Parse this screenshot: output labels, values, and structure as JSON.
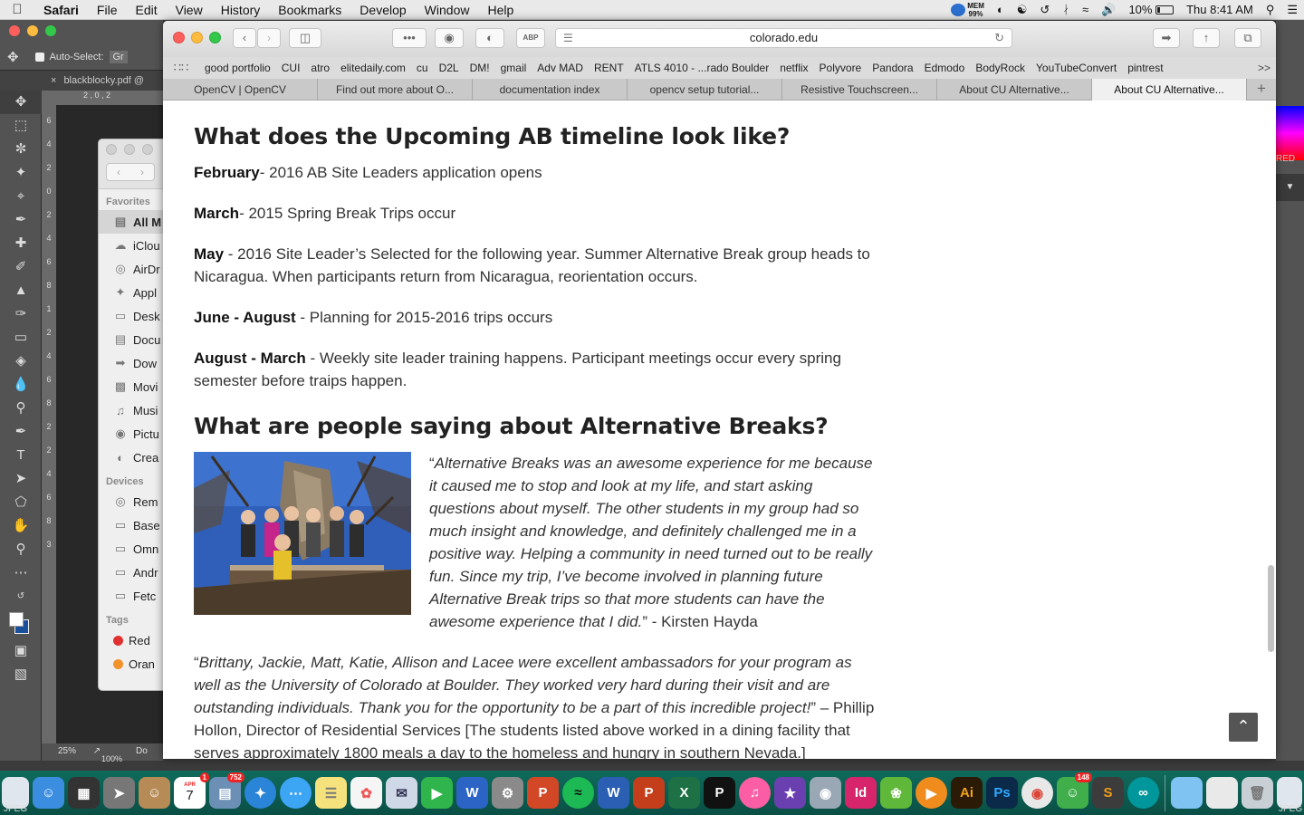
{
  "menubar": {
    "app": "Safari",
    "items": [
      "File",
      "Edit",
      "View",
      "History",
      "Bookmarks",
      "Develop",
      "Window",
      "Help"
    ],
    "mem_label": "MEM",
    "mem_value": "99%",
    "battery": "10%",
    "clock": "Thu 8:41 AM"
  },
  "photoshop": {
    "auto_select_label": "Auto-Select:",
    "auto_select_value": "Gr",
    "doc_tab": "blackblocky.pdf @",
    "zoom": "25%",
    "zoom2": "100%",
    "doc_label": "Do",
    "right_label": "RED",
    "ruler_marks": [
      "6",
      "4",
      "2",
      "0",
      "2",
      "4",
      "6",
      "8",
      "1",
      "2",
      "4",
      "6",
      "8",
      "2",
      "2",
      "4",
      "6",
      "8",
      "3"
    ],
    "hruler_marks": "2 , 0 , 2"
  },
  "finder": {
    "favorites_label": "Favorites",
    "favorites": [
      "All M",
      "iClou",
      "AirDr",
      "Appl",
      "Desk",
      "Docu",
      "Dow",
      "Movi",
      "Musi",
      "Pictu",
      "Crea"
    ],
    "devices_label": "Devices",
    "devices": [
      "Rem",
      "Base",
      "Omn",
      "Andr",
      "Fetc"
    ],
    "tags_label": "Tags",
    "tags": [
      {
        "name": "Red",
        "color": "#e0302f"
      },
      {
        "name": "Oran",
        "color": "#f2922a"
      }
    ]
  },
  "safari": {
    "url": "colorado.edu",
    "bookmarks": [
      "good portfolio",
      "CUI",
      "atro",
      "elitedaily.com",
      "cu",
      "D2L",
      "DM!",
      "gmail",
      "Adv MAD",
      "RENT",
      "ATLS 4010 - ...rado Boulder",
      "netflix",
      "Polyvore",
      "Pandora",
      "Edmodo",
      "BodyRock",
      "YouTubeConvert",
      "pintrest"
    ],
    "bookmarks_more": ">>",
    "tabs": [
      "OpenCV | OpenCV",
      "Find out more about O...",
      "documentation index",
      "opencv setup tutorial...",
      "Resistive Touchscreen...",
      "About CU Alternative...",
      "About CU Alternative..."
    ],
    "active_tab_index": 6
  },
  "page": {
    "heading1": "What does the Upcoming AB timeline look like?",
    "timeline": [
      {
        "term": "February",
        "text": "- 2016 AB Site Leaders application opens"
      },
      {
        "term": "March",
        "text": "- 2015 Spring Break Trips occur"
      },
      {
        "term": "May",
        "text": " - 2016 Site Leader’s Selected for the following year. Summer Alternative Break group heads to Nicaragua. When participants return from Nicaragua, reorientation occurs."
      },
      {
        "term": "June - August",
        "text": " - Planning for 2015-2016 trips occurs"
      },
      {
        "term": "August - March",
        "text": " - Weekly site leader training happens. Participant meetings occur every spring semester before traips happen."
      }
    ],
    "heading2": "What are people saying about Alternative Breaks?",
    "quote1_open": "“",
    "quote1_text": "Alternative Breaks was an awesome experience for me because it caused me to stop and look at my life, and start asking questions about myself.  The other students in my group had so much insight and knowledge, and definitely challenged me in a positive way.  Helping a community in need turned out to be really fun. Since my trip, I’ve become involved in planning future Alternative Break trips so that more students can have the awesome experience that I did.",
    "quote1_attr": "”  - Kirsten Hayda",
    "quote2_open": "“",
    "quote2_text": "Brittany, Jackie, Matt, Katie, Allison and Lacee were excellent ambassadors for your program as well as the University of Colorado at Boulder. They worked very hard during their visit and are outstanding individuals. Thank you for the opportunity to be a part of this incredible project!",
    "quote2_attr": "” – Phillip Hollon, Director of Residential Services [The students listed above worked in a dining facility that serves approximately 1800 meals a day to the homeless and hungry in southern Nevada.]"
  },
  "dock": {
    "calendar_month": "APR",
    "calendar_day": "7",
    "calendar_badge": "1",
    "preview_badge": "752",
    "cartoon_badge": "148",
    "jpeg_label": "JPEG",
    "apps": [
      {
        "name": "finder-icon",
        "color": "#3b8de0"
      },
      {
        "name": "dashboard-icon",
        "color": "#333"
      },
      {
        "name": "launchpad-icon",
        "color": "#777"
      },
      {
        "name": "contacts-icon",
        "color": "#b68b55"
      },
      {
        "name": "calendar-icon",
        "color": "#fff"
      },
      {
        "name": "preview-icon",
        "color": "#6c8fb6"
      },
      {
        "name": "safari-icon",
        "color": "#2a84d8"
      },
      {
        "name": "messages-icon",
        "color": "#3ca5f4"
      },
      {
        "name": "notes-icon",
        "color": "#f6e27c"
      },
      {
        "name": "photos-icon",
        "color": "#f5f5f5"
      },
      {
        "name": "mail-icon",
        "color": "#cfd8e6"
      },
      {
        "name": "facetime-icon",
        "color": "#2fb54c"
      },
      {
        "name": "word-icon",
        "color": "#2b64c4"
      },
      {
        "name": "system-prefs-icon",
        "color": "#8a8a8a"
      },
      {
        "name": "powerpoint-icon",
        "color": "#d24726"
      },
      {
        "name": "spotify-icon",
        "color": "#1db954"
      },
      {
        "name": "word2-icon",
        "color": "#2b5fb3"
      },
      {
        "name": "powerpoint2-icon",
        "color": "#c43e1c"
      },
      {
        "name": "excel-icon",
        "color": "#1e7145"
      },
      {
        "name": "pandora-icon",
        "color": "#111"
      },
      {
        "name": "itunes-icon",
        "color": "#fb5ea4"
      },
      {
        "name": "imovie-icon",
        "color": "#6a3fb0"
      },
      {
        "name": "image-capture-icon",
        "color": "#9aa7b4"
      },
      {
        "name": "indesign-icon",
        "color": "#d6256b"
      },
      {
        "name": "leaf-icon",
        "color": "#5fb83a"
      },
      {
        "name": "vlc-icon",
        "color": "#f08c1e"
      },
      {
        "name": "illustrator-icon",
        "color": "#2b1a05"
      },
      {
        "name": "photoshop-icon",
        "color": "#0b2a4a"
      },
      {
        "name": "chrome-icon",
        "color": "#e8e8e8"
      },
      {
        "name": "cartoon-icon",
        "color": "#3fae4b"
      },
      {
        "name": "sublime-icon",
        "color": "#3c3c3c"
      },
      {
        "name": "arduino-icon",
        "color": "#00979c"
      },
      {
        "name": "folder-icon",
        "color": "#7ec3f2"
      },
      {
        "name": "documents-icon",
        "color": "#e9e9e9"
      },
      {
        "name": "trash-icon",
        "color": "#c8d0d6"
      }
    ]
  }
}
